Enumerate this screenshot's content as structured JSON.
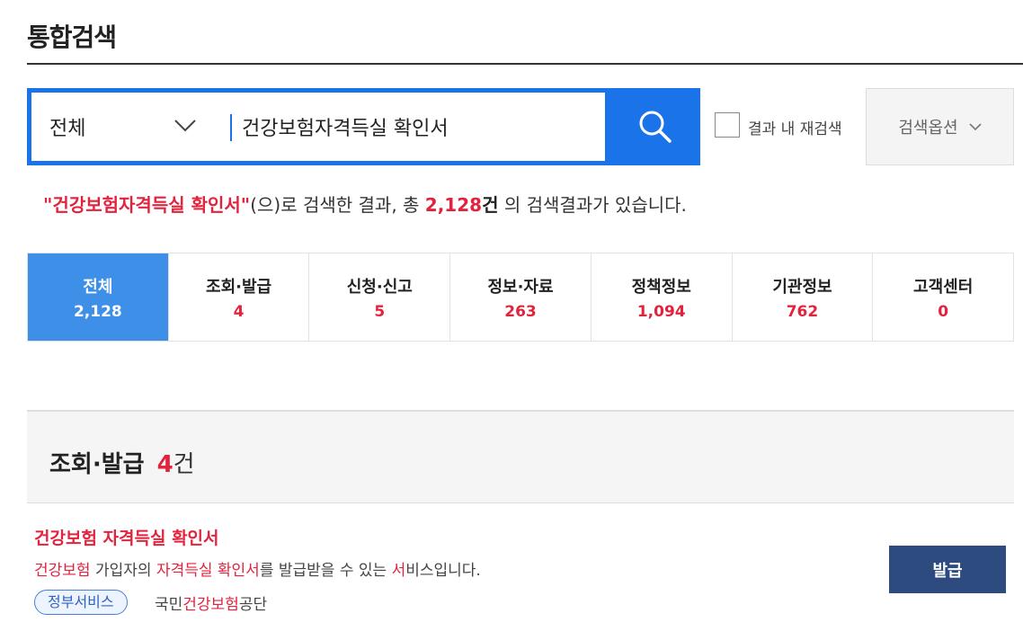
{
  "header": {
    "title": "통합검색"
  },
  "search": {
    "scope_label": "전체",
    "query": "건강보험자격득실 확인서",
    "refine_label": "결과 내 재검색",
    "options_label": "검색옵션"
  },
  "summary": {
    "query_quoted": "\"건강보험자격득실 확인서\"",
    "text_1": "(으)로 검색한 결과, 총 ",
    "total": "2,128",
    "unit": "건",
    "text_2": " 의 검색결과가 있습니다."
  },
  "tabs": [
    {
      "label": "전체",
      "count": "2,128",
      "active": true
    },
    {
      "label": "조회·발급",
      "count": "4"
    },
    {
      "label": "신청·신고",
      "count": "5"
    },
    {
      "label": "정보·자료",
      "count": "263"
    },
    {
      "label": "정책정보",
      "count": "1,094"
    },
    {
      "label": "기관정보",
      "count": "762"
    },
    {
      "label": "고객센터",
      "count": "0"
    }
  ],
  "section": {
    "title": "조회·발급",
    "count": "4",
    "unit": "건"
  },
  "result": {
    "title": "건강보험 자격득실 확인서",
    "desc_parts": [
      "건강보험",
      " 가입자의 ",
      "자격득실 확인서",
      "를 발급받을 수 있는 ",
      "서",
      "비스입니다."
    ],
    "tag": "정부서비스",
    "org_parts": [
      "국민",
      "건강보험",
      "공단"
    ],
    "action_label": "발급"
  },
  "colors": {
    "brand_blue": "#1a73e8",
    "active_tab": "#3d8fe8",
    "highlight_red": "#e2233d",
    "issue_button": "#2d4b7e"
  }
}
